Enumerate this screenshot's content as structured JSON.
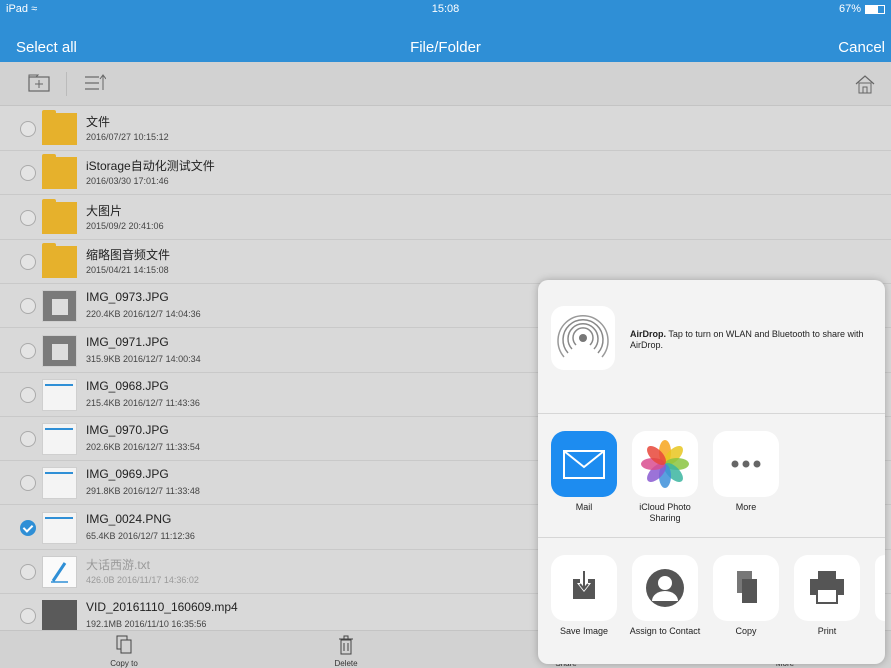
{
  "status_bar": {
    "device": "iPad",
    "wifi_icon": "wifi-icon",
    "time": "15:08",
    "battery": "67%"
  },
  "nav": {
    "select_all": "Select all",
    "title": "File/Folder",
    "cancel": "Cancel"
  },
  "toolbar": {
    "icons": [
      "new-folder-icon",
      "sort-icon",
      "home-icon"
    ]
  },
  "files": [
    {
      "name": "文件",
      "meta": "2016/07/27 10:15:12",
      "type": "folder",
      "checked": false
    },
    {
      "name": "iStorage自动化测试文件",
      "meta": "2016/03/30 17:01:46",
      "type": "folder",
      "checked": false
    },
    {
      "name": "大图片",
      "meta": "2015/09/2 20:41:06",
      "type": "folder",
      "checked": false
    },
    {
      "name": "缩略图音频文件",
      "meta": "2015/04/21 14:15:08",
      "type": "folder",
      "checked": false
    },
    {
      "name": "IMG_0973.JPG",
      "meta": "220.4KB 2016/12/7 14:04:36",
      "type": "image-dark",
      "checked": false
    },
    {
      "name": "IMG_0971.JPG",
      "meta": "315.9KB 2016/12/7 14:00:34",
      "type": "image-dark",
      "checked": false
    },
    {
      "name": "IMG_0968.JPG",
      "meta": "215.4KB 2016/12/7 11:43:36",
      "type": "image",
      "checked": false
    },
    {
      "name": "IMG_0970.JPG",
      "meta": "202.6KB 2016/12/7 11:33:54",
      "type": "image",
      "checked": false
    },
    {
      "name": "IMG_0969.JPG",
      "meta": "291.8KB 2016/12/7 11:33:48",
      "type": "image",
      "checked": false
    },
    {
      "name": "IMG_0024.PNG",
      "meta": "65.4KB 2016/12/7 11:12:36",
      "type": "image",
      "checked": true
    },
    {
      "name": "大话西游.txt",
      "meta": "426.0B 2016/11/17 14:36:02",
      "type": "text",
      "checked": false,
      "dim": true
    },
    {
      "name": "VID_20161110_160609.mp4",
      "meta": "192.1MB 2016/11/10 16:35:56",
      "type": "video",
      "checked": false
    }
  ],
  "bottom_bar": [
    {
      "label": "Copy to",
      "icon": "copy-to-icon"
    },
    {
      "label": "Delete",
      "icon": "trash-icon"
    },
    {
      "label": "Share",
      "icon": "share-icon"
    },
    {
      "label": "More",
      "icon": "more-icon"
    }
  ],
  "share_sheet": {
    "airdrop_title": "AirDrop.",
    "airdrop_text": "Tap to turn on WLAN and Bluetooth to share with AirDrop.",
    "apps": [
      {
        "label": "Mail",
        "icon": "mail-icon"
      },
      {
        "label": "iCloud Photo Sharing",
        "icon": "photos-icon"
      },
      {
        "label": "More",
        "icon": "more-dots-icon"
      }
    ],
    "actions": [
      {
        "label": "Save Image",
        "icon": "save-image-icon"
      },
      {
        "label": "Assign to Contact",
        "icon": "contact-icon"
      },
      {
        "label": "Copy",
        "icon": "copy-icon"
      },
      {
        "label": "Print",
        "icon": "print-icon"
      }
    ]
  },
  "colors": {
    "accent": "#2f8fd6",
    "folder": "#e6b12c",
    "background": "#d9d9d9"
  }
}
